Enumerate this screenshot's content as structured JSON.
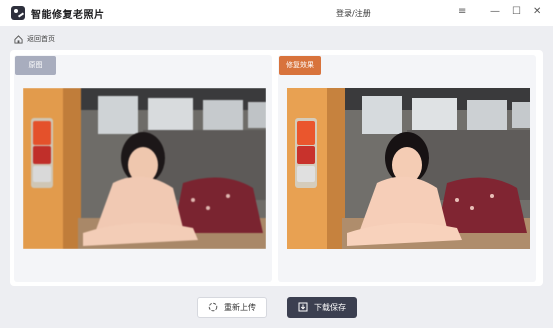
{
  "app": {
    "title": "智能修复老照片",
    "login_label": "登录/注册",
    "menu_icon": "≡",
    "minimize_icon": "—",
    "maximize_icon": "☐",
    "close_icon": "✕"
  },
  "nav": {
    "back_label": "返回首页"
  },
  "compare": {
    "original_label": "原图",
    "repaired_label": "修复效果"
  },
  "actions": {
    "reupload_label": "重新上传",
    "download_label": "下载保存"
  },
  "colors": {
    "accent_orange": "#d8733c",
    "original_tag": "#a8adbe",
    "primary_dark": "#3b3f50",
    "background": "#edeef2"
  }
}
